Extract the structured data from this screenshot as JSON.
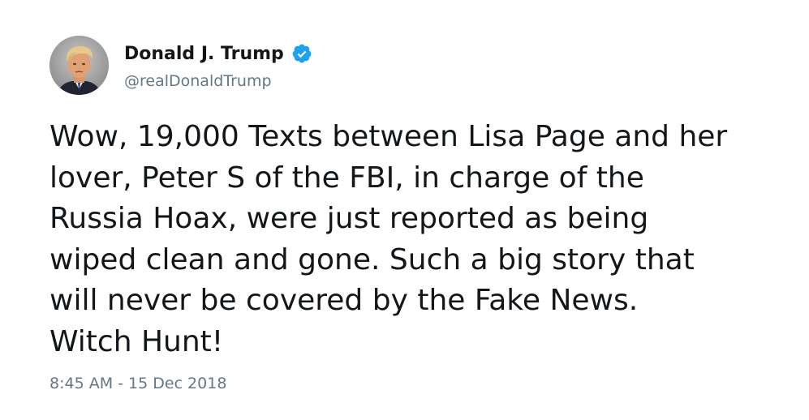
{
  "author": {
    "display_name": "Donald J. Trump",
    "handle": "@realDonaldTrump",
    "verified_icon": "verified-badge-icon",
    "avatar_icon": "profile-photo"
  },
  "tweet": {
    "lines": [
      "Wow, 19,000 Texts between Lisa Page and her",
      "lover, Peter S of the FBI, in charge of the",
      "Russia Hoax, were just reported as being",
      "wiped clean and gone. Such a big story that",
      "will never be covered by the Fake News.",
      "Witch Hunt!"
    ],
    "timestamp": "8:45 AM - 15 Dec 2018"
  },
  "colors": {
    "text": "#14171a",
    "muted": "#657786",
    "verified": "#1da1f2",
    "background": "#ffffff"
  }
}
